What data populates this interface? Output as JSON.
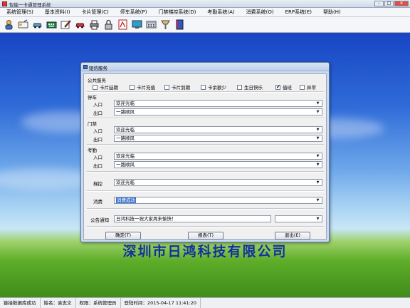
{
  "window": {
    "title": "智能一卡通管理系统"
  },
  "menu": [
    "系统管理(S)",
    "基本资料(I)",
    "卡片管理(C)",
    "停车系统(P)",
    "门禁梯控系统(D)",
    "考勤系统(A)",
    "消费系统(O)",
    "ERP系统(E)",
    "帮助(H)"
  ],
  "toolbar_icons": [
    "user-icon",
    "card-icon",
    "car-icon",
    "keyboard-icon",
    "edit-icon",
    "car-red-icon",
    "print-icon",
    "lock-icon",
    "pdf-icon",
    "monitor-icon",
    "calculator-icon",
    "fan-icon",
    "book-icon"
  ],
  "company": "深圳市日鸿科技有限公司",
  "status": {
    "db": "链接数据库成功",
    "name": "姓名：袁志文",
    "role": "权限：系统管理员",
    "login": "登陆时间：2015-04-17 11:41:20"
  },
  "dialog": {
    "title": "短信服务",
    "public_service": "公共服务",
    "checkboxes": [
      {
        "label": "卡片延期",
        "checked": false
      },
      {
        "label": "卡片充值",
        "checked": false
      },
      {
        "label": "卡片到期",
        "checked": false
      },
      {
        "label": "卡余额少",
        "checked": false
      },
      {
        "label": "生日快乐",
        "checked": false
      },
      {
        "label": "值班",
        "checked": true
      },
      {
        "label": "异常",
        "checked": false
      }
    ],
    "parking": {
      "label": "停车",
      "entry_label": "入口",
      "entry": "欢迎光临",
      "exit_label": "出口",
      "exit": "一路顺风"
    },
    "access": {
      "label": "门禁",
      "entry_label": "入口",
      "entry": "欢迎光临",
      "exit_label": "出口",
      "exit": "一路顺风"
    },
    "attendance": {
      "label": "考勤",
      "entry_label": "入口",
      "entry": "欢迎光临",
      "exit_label": "出口",
      "exit": "一路顺风"
    },
    "elevator": {
      "label": "梯控",
      "value": "欢迎光临"
    },
    "consume": {
      "label": "消费",
      "value": "消费成功"
    },
    "notice": {
      "label": "公告通知",
      "value": "日鸿科技一祝大家周末愉快！"
    },
    "buttons": {
      "ok": "确定(T)",
      "report": "报表(T)",
      "exit": "退出(E)"
    }
  }
}
